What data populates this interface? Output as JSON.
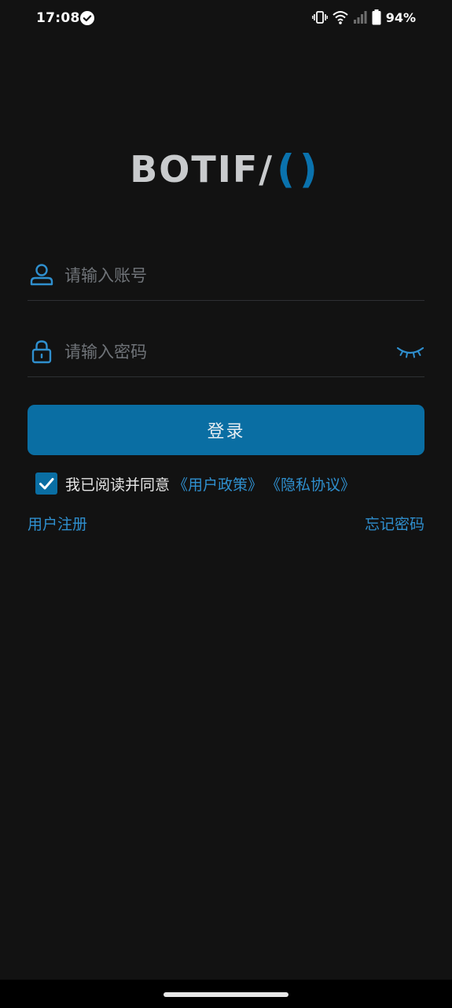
{
  "status_bar": {
    "time": "17:08",
    "battery": "94%",
    "icons": [
      "check-circle-icon",
      "vibrate-icon",
      "wifi-icon",
      "signal-icon",
      "battery-icon"
    ]
  },
  "logo": {
    "text": "BOTIF",
    "mark": "/",
    "accent": "()",
    "accent_color": "#0a72ad"
  },
  "login_form": {
    "account_placeholder": "请输入账号",
    "password_placeholder": "请输入密码",
    "login_label": "登录",
    "button_color": "#0a6ea3"
  },
  "agreement": {
    "checked": true,
    "text": "我已阅读并同意",
    "policy_link": "《用户政策》",
    "privacy_link": "《隐私协议》",
    "link_color": "#2f8fce"
  },
  "links": {
    "register": "用户注册",
    "forgot": "忘记密码"
  }
}
